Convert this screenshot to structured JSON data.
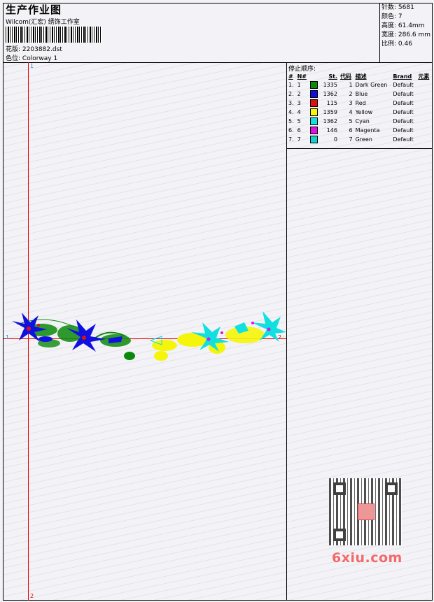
{
  "header": {
    "title": "生产作业图",
    "company": "Wilcom(汇宏) 绣饰工作室",
    "file_label": "花版:",
    "file_value": "2203882.dst",
    "colorway_label": "色位:",
    "colorway_value": "Colorway 1"
  },
  "stats": {
    "stitches": "针数: 5681",
    "colors": "颜色: 7",
    "height": "高度: 61.4mm",
    "width": "宽度: 286.6 mm",
    "scale": "比例: 0.46"
  },
  "markers": {
    "top_1": "1",
    "bottom_2": "2",
    "left_1": "1",
    "right_2": "2"
  },
  "sequence": {
    "title": "停止顺序:",
    "headers": [
      "#",
      "N#",
      "St.",
      "代码",
      "描述",
      "Brand",
      "元素"
    ],
    "rows": [
      {
        "idx": "1.",
        "n": "1",
        "color": "#0a8a0a",
        "st": "1335",
        "code": "1",
        "desc": "Dark Green",
        "brand": "Default"
      },
      {
        "idx": "2.",
        "n": "2",
        "color": "#1010e0",
        "st": "1362",
        "code": "2",
        "desc": "Blue",
        "brand": "Default"
      },
      {
        "idx": "3.",
        "n": "3",
        "color": "#e01010",
        "st": "115",
        "code": "3",
        "desc": "Red",
        "brand": "Default"
      },
      {
        "idx": "4.",
        "n": "4",
        "color": "#f5f50a",
        "st": "1359",
        "code": "4",
        "desc": "Yellow",
        "brand": "Default"
      },
      {
        "idx": "5.",
        "n": "5",
        "color": "#10e0e0",
        "st": "1362",
        "code": "5",
        "desc": "Cyan",
        "brand": "Default"
      },
      {
        "idx": "6.",
        "n": "6",
        "color": "#e010e0",
        "st": "146",
        "code": "6",
        "desc": "Magenta",
        "brand": "Default"
      },
      {
        "idx": "7.",
        "n": "7",
        "color": "#10d0d0",
        "st": "0",
        "code": "7",
        "desc": "Green",
        "brand": "Default"
      }
    ]
  },
  "watermark": {
    "text": "6xiu.com"
  }
}
